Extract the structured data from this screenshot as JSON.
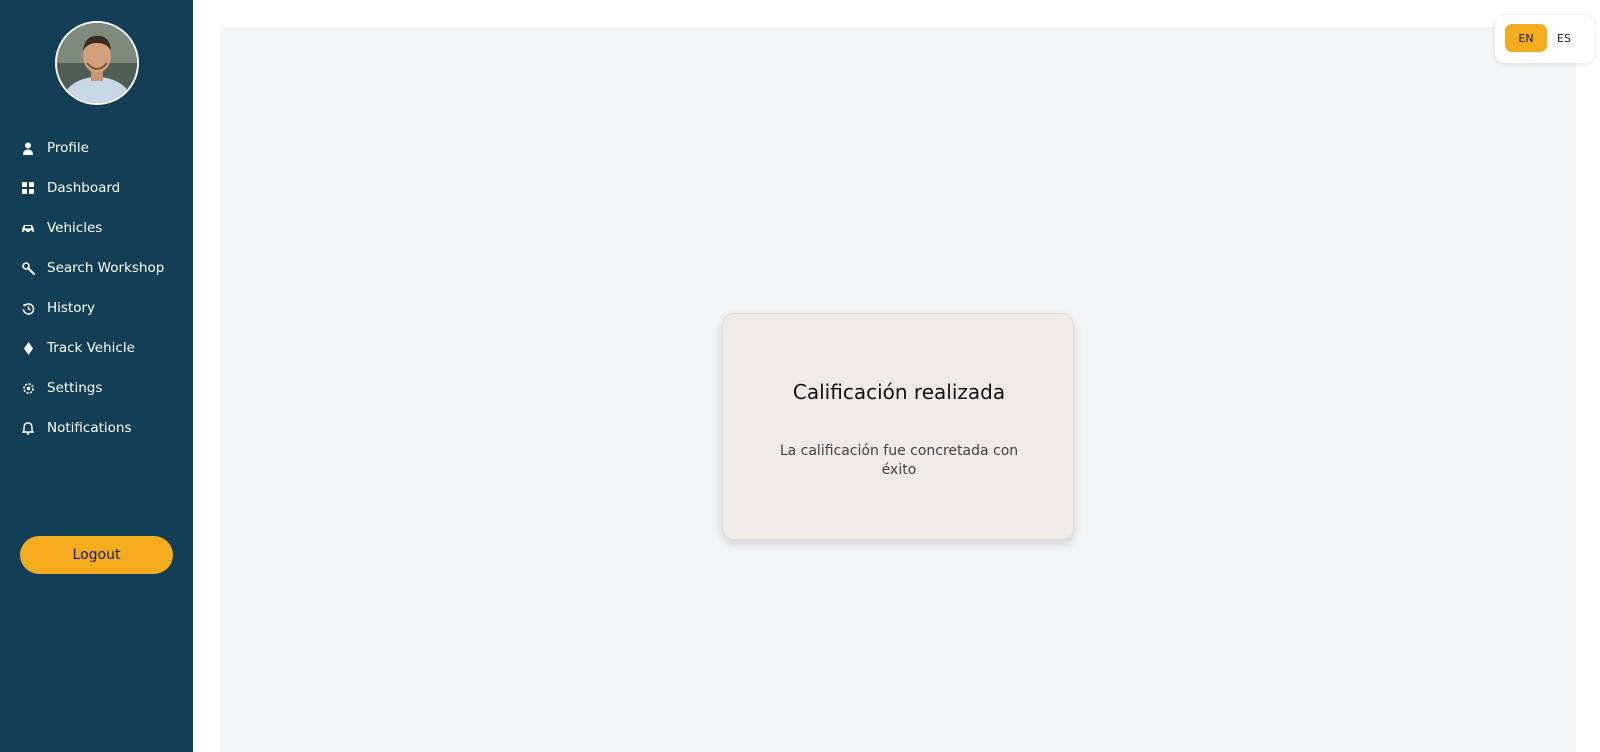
{
  "sidebar": {
    "items": [
      {
        "label": "Profile",
        "icon": "user-icon"
      },
      {
        "label": "Dashboard",
        "icon": "grid-icon"
      },
      {
        "label": "Vehicles",
        "icon": "car-icon"
      },
      {
        "label": "Search Workshop",
        "icon": "wrench-icon"
      },
      {
        "label": "History",
        "icon": "history-icon"
      },
      {
        "label": "Track Vehicle",
        "icon": "location-icon"
      },
      {
        "label": "Settings",
        "icon": "gear-icon"
      },
      {
        "label": "Notifications",
        "icon": "bell-icon"
      }
    ],
    "logout_label": "Logout"
  },
  "lang": {
    "en": "EN",
    "es": "ES",
    "active": "EN"
  },
  "card": {
    "title": "Calificación realizada",
    "message": "La calificación fue concretada con éxito"
  },
  "colors": {
    "sidebar": "#123f55",
    "accent": "#f2ac1e",
    "main_bg": "#f4f5f7",
    "card_bg": "#f0ebe6"
  }
}
